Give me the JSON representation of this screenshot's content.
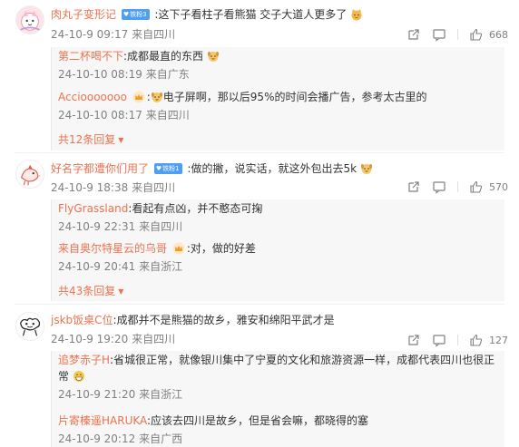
{
  "comments": [
    {
      "user": "肉丸子变形记",
      "badge": "铁粉3",
      "text": ":这下子看柱子看熊猫 交子大道人更多了",
      "emoji": "cat-face-emoji",
      "date": "24-10-9 09:17",
      "location": "来自四川",
      "likes": "668",
      "replies": [
        {
          "user": "第二杯喝不下",
          "text": ":成都最直的东西",
          "emoji": "dog-face-emoji",
          "date": "24-10-10 08:19",
          "location": "来自广东"
        },
        {
          "user": "Acciooooooo",
          "crown": true,
          "text": "电子屏啊，那以后95%的时间会播广告，参考太古里的",
          "emoji_before": "dog-face-emoji",
          "date": "24-10-10 08:17",
          "location": "来自四川"
        }
      ],
      "more": "共12条回复"
    },
    {
      "user": "好名字都遭你们用了",
      "badge": "铁粉1",
      "text": ":做的撇，说实话，就这外包出去5k",
      "emoji": "dog-face-emoji",
      "date": "24-10-9 18:38",
      "location": "来自四川",
      "likes": "570",
      "replies": [
        {
          "user": "FlyGrassland",
          "text": ":看起有点凶，并不憨态可掬",
          "date": "24-10-9 22:31",
          "location": "来自四川"
        },
        {
          "user": "来自奥尔特星云的乌哥",
          "crown": true,
          "text": ":对，做的好差",
          "date": "24-10-9 20:41",
          "location": "来自浙江"
        }
      ],
      "more": "共43条回复"
    },
    {
      "user": "jskb饭桌C位",
      "text": ":成都并不是熊猫的故乡，雅安和绵阳平武才是",
      "date": "24-10-9 19:20",
      "location": "来自四川",
      "likes": "127",
      "replies": [
        {
          "user": "追梦赤子H",
          "text": ":省城很正常，就像银川集中了宁夏的文化和旅游资源一样，成都代表四川也很正常",
          "emoji_line2": "grin-emoji",
          "date": "24-10-9 21:20",
          "location": "来自浙江"
        },
        {
          "user": "片寄榛遥HARUKA",
          "text": ":应该去四川是故乡，但是省会嘛，都晓得的塞",
          "date": "24-10-9 20:12",
          "location": "来自广西"
        }
      ]
    }
  ]
}
